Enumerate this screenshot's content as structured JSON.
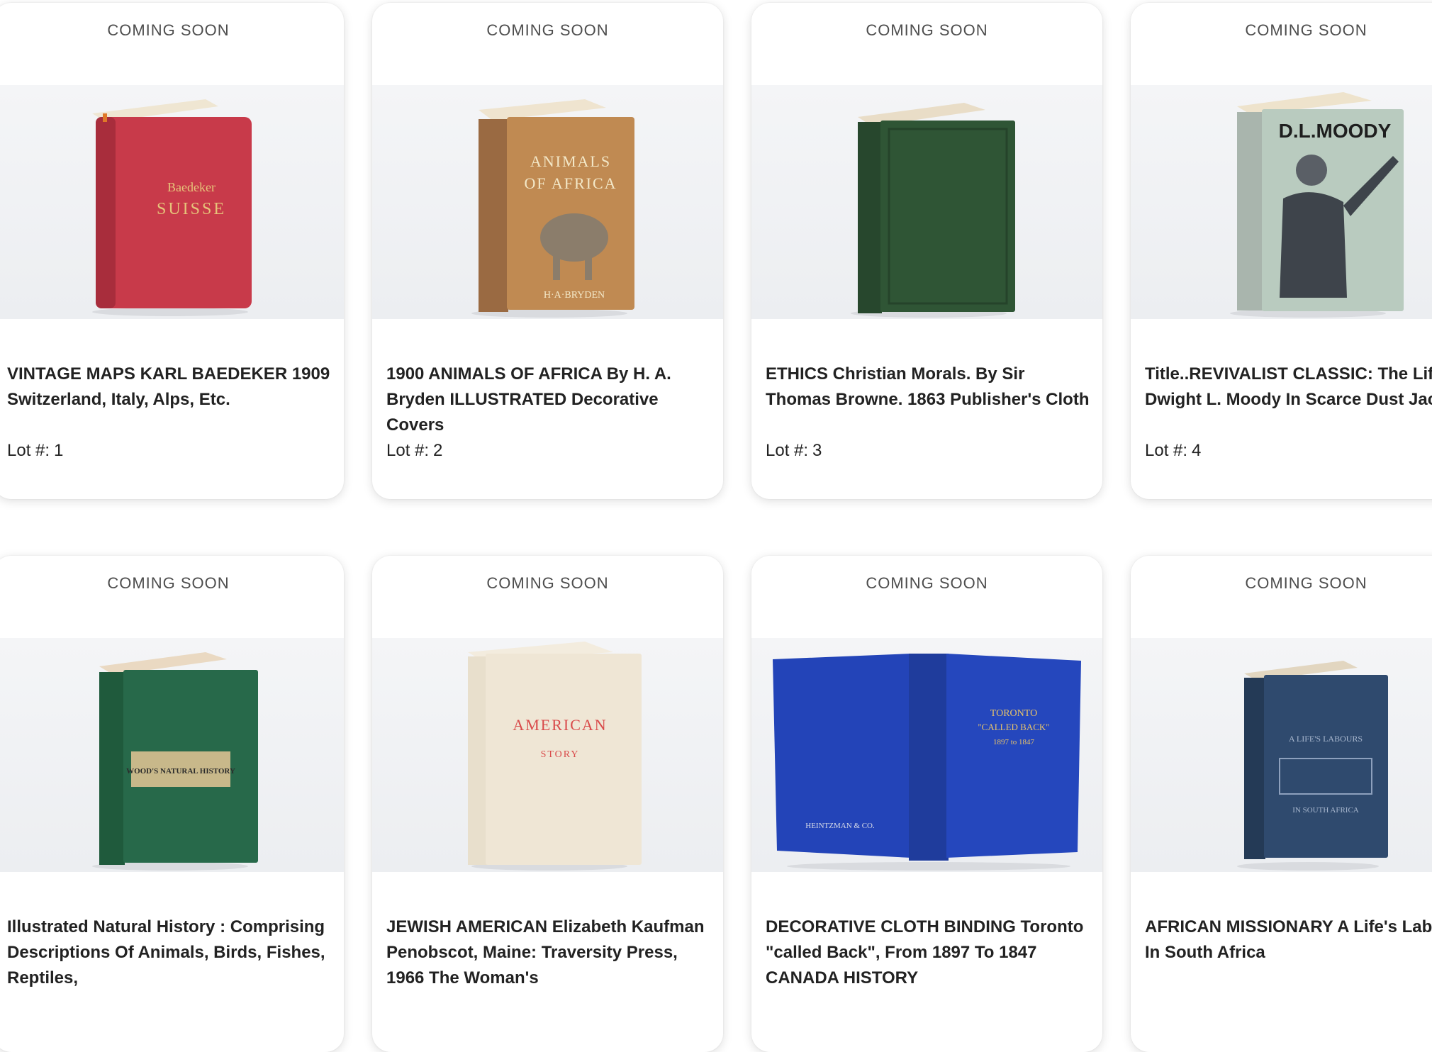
{
  "lots": [
    {
      "status": "COMING SOON",
      "title": "VINTAGE MAPS KARL BAEDEKER 1909 Switzerland, Italy, Alps, Etc.",
      "lot_label": "Lot #:",
      "lot_number": "1",
      "cover_text": [
        "Baedeker",
        "SUISSE"
      ]
    },
    {
      "status": "COMING SOON",
      "title": "1900 ANIMALS OF AFRICA By H. A. Bryden ILLUSTRATED Decorative Covers",
      "lot_label": "Lot #:",
      "lot_number": "2",
      "cover_text": [
        "ANIMALS",
        "OF AFRICA",
        "H·A·BRYDEN"
      ]
    },
    {
      "status": "COMING SOON",
      "title": "ETHICS Christian Morals. By Sir Thomas Browne. 1863 Publisher's Cloth",
      "lot_label": "Lot #:",
      "lot_number": "3",
      "cover_text": []
    },
    {
      "status": "COMING SOON",
      "title": "Title..REVIVALIST CLASSIC: The Life Of Dwight L. Moody In Scarce Dust Jacket",
      "lot_label": "Lot #:",
      "lot_number": "4",
      "cover_text": [
        "D.L.MOODY"
      ]
    },
    {
      "status": "COMING SOON",
      "title": "Illustrated Natural History : Comprising Descriptions Of Animals, Birds, Fishes, Reptiles,",
      "lot_label": "",
      "lot_number": "",
      "cover_text": [
        "WOOD'S NATURAL HISTORY"
      ]
    },
    {
      "status": "COMING SOON",
      "title": "JEWISH AMERICAN Elizabeth Kaufman Penobscot, Maine: Traversity Press, 1966 The Woman's",
      "lot_label": "",
      "lot_number": "",
      "cover_text": [
        "AMERICAN",
        "STORY"
      ]
    },
    {
      "status": "COMING SOON",
      "title": "DECORATIVE CLOTH BINDING Toronto \"called Back\", From 1897 To 1847 CANADA HISTORY",
      "lot_label": "",
      "lot_number": "",
      "cover_text": [
        "TORONTO",
        "\"CALLED BACK\"",
        "1897 to 1847",
        "HEINTZMAN & CO."
      ]
    },
    {
      "status": "COMING SOON",
      "title": "AFRICAN MISSIONARY A Life's Labours In South Africa",
      "lot_label": "",
      "lot_number": "",
      "cover_text": [
        "A LIFE'S LABOURS",
        "IN SOUTH AFRICA"
      ]
    }
  ],
  "colors": {
    "card_bg": "#ffffff",
    "status_text": "#4d4d4d",
    "title_text": "#222222",
    "photo_bg": "#eef0f3"
  }
}
